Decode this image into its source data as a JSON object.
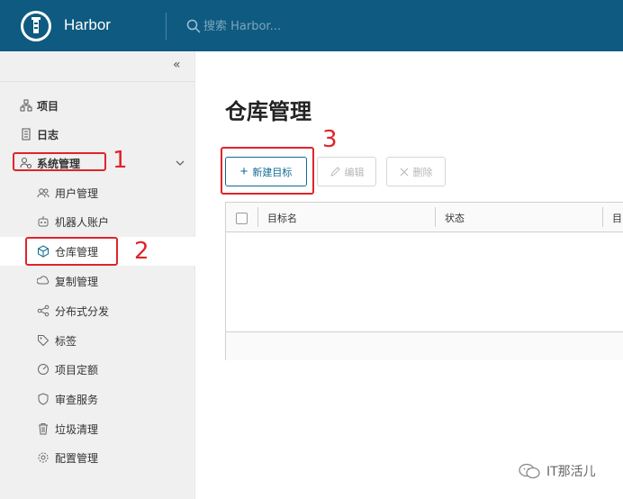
{
  "header": {
    "app_title": "Harbor",
    "search_placeholder": "搜索 Harbor..."
  },
  "sidebar": {
    "collapse_glyph": "«",
    "items": [
      {
        "label": "项目",
        "icon": "projects-icon"
      },
      {
        "label": "日志",
        "icon": "log-icon"
      },
      {
        "label": "系统管理",
        "icon": "admin-icon",
        "expanded": true
      },
      {
        "label": "用户管理",
        "icon": "users-icon"
      },
      {
        "label": "机器人账户",
        "icon": "robot-icon"
      },
      {
        "label": "仓库管理",
        "icon": "registry-icon",
        "active": true
      },
      {
        "label": "复制管理",
        "icon": "replication-icon"
      },
      {
        "label": "分布式分发",
        "icon": "distribution-icon"
      },
      {
        "label": "标签",
        "icon": "tag-icon"
      },
      {
        "label": "项目定额",
        "icon": "quota-icon"
      },
      {
        "label": "审查服务",
        "icon": "shield-icon"
      },
      {
        "label": "垃圾清理",
        "icon": "trash-icon"
      },
      {
        "label": "配置管理",
        "icon": "gear-icon"
      }
    ]
  },
  "main": {
    "title": "仓库管理",
    "toolbar": {
      "new_label": "新建目标",
      "edit_label": "编辑",
      "delete_label": "删除"
    },
    "table": {
      "columns": [
        "目标名",
        "状态",
        "目"
      ]
    }
  },
  "annotations": {
    "one": "1",
    "two": "2",
    "three": "3",
    "color": "#e0242b"
  },
  "watermark": {
    "text": "IT那活儿"
  },
  "colors": {
    "header_bg": "#0f5a80",
    "accent": "#0f6a94",
    "sidebar_bg": "#f0f0f0"
  }
}
